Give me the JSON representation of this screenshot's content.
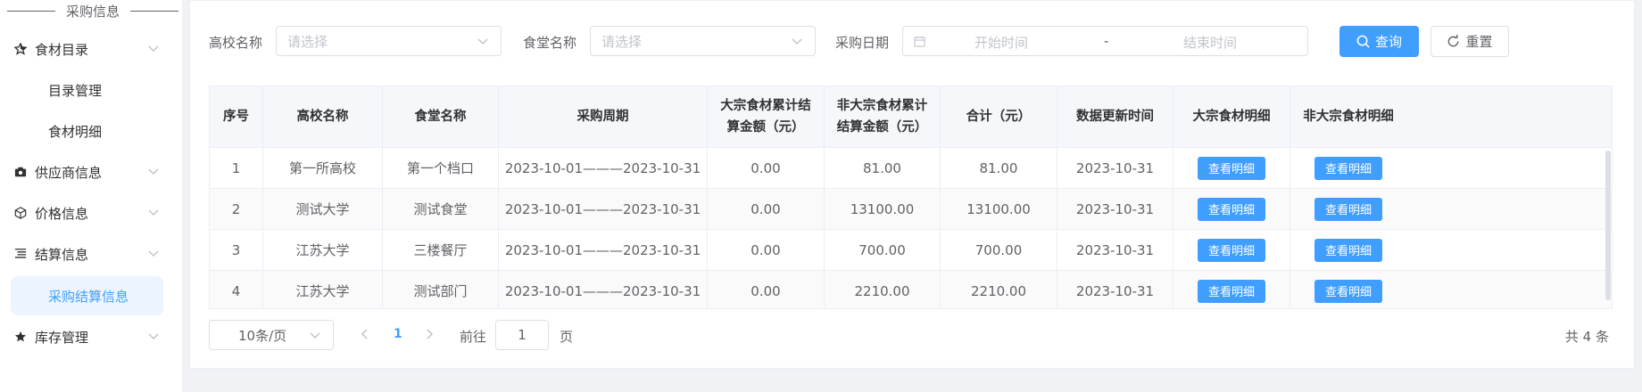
{
  "sidebar": {
    "section_title": "采购信息",
    "menu": [
      {
        "label": "食材目录",
        "icon": "star-cut-icon"
      },
      {
        "label": "供应商信息",
        "icon": "camera-icon"
      },
      {
        "label": "价格信息",
        "icon": "box-icon"
      },
      {
        "label": "结算信息",
        "icon": "list-icon"
      },
      {
        "label": "库存管理",
        "icon": "star-icon"
      }
    ],
    "submenu_catalog": [
      "目录管理",
      "食材明细"
    ],
    "submenu_settlement": [
      "采购结算信息"
    ]
  },
  "filters": {
    "school_label": "高校名称",
    "school_placeholder": "请选择",
    "canteen_label": "食堂名称",
    "canteen_placeholder": "请选择",
    "date_label": "采购日期",
    "start_placeholder": "开始时间",
    "range_separator": "-",
    "end_placeholder": "结束时间",
    "search_label": "查询",
    "reset_label": "重置"
  },
  "table": {
    "columns": [
      "序号",
      "高校名称",
      "食堂名称",
      "采购周期",
      "大宗食材累计结算金额（元）",
      "非大宗食材累计结算金额（元）",
      "合计（元）",
      "数据更新时间",
      "大宗食材明细",
      "非大宗食材明细"
    ],
    "detail_label": "查看明细",
    "rows": [
      [
        "1",
        "第一所高校",
        "第一个档口",
        "2023-10-01———2023-10-31",
        "0.00",
        "81.00",
        "81.00",
        "2023-10-31"
      ],
      [
        "2",
        "测试大学",
        "测试食堂",
        "2023-10-01———2023-10-31",
        "0.00",
        "13100.00",
        "13100.00",
        "2023-10-31"
      ],
      [
        "3",
        "江苏大学",
        "三楼餐厅",
        "2023-10-01———2023-10-31",
        "0.00",
        "700.00",
        "700.00",
        "2023-10-31"
      ],
      [
        "4",
        "江苏大学",
        "测试部门",
        "2023-10-01———2023-10-31",
        "0.00",
        "2210.00",
        "2210.00",
        "2023-10-31"
      ]
    ]
  },
  "pagination": {
    "page_size": "10条/页",
    "current_page": "1",
    "goto_label": "前往",
    "goto_value": "1",
    "goto_suffix": "页",
    "total": "共 4 条"
  },
  "colors": {
    "primary": "#409eff",
    "active_menu_bg": "#ecf5ff"
  }
}
